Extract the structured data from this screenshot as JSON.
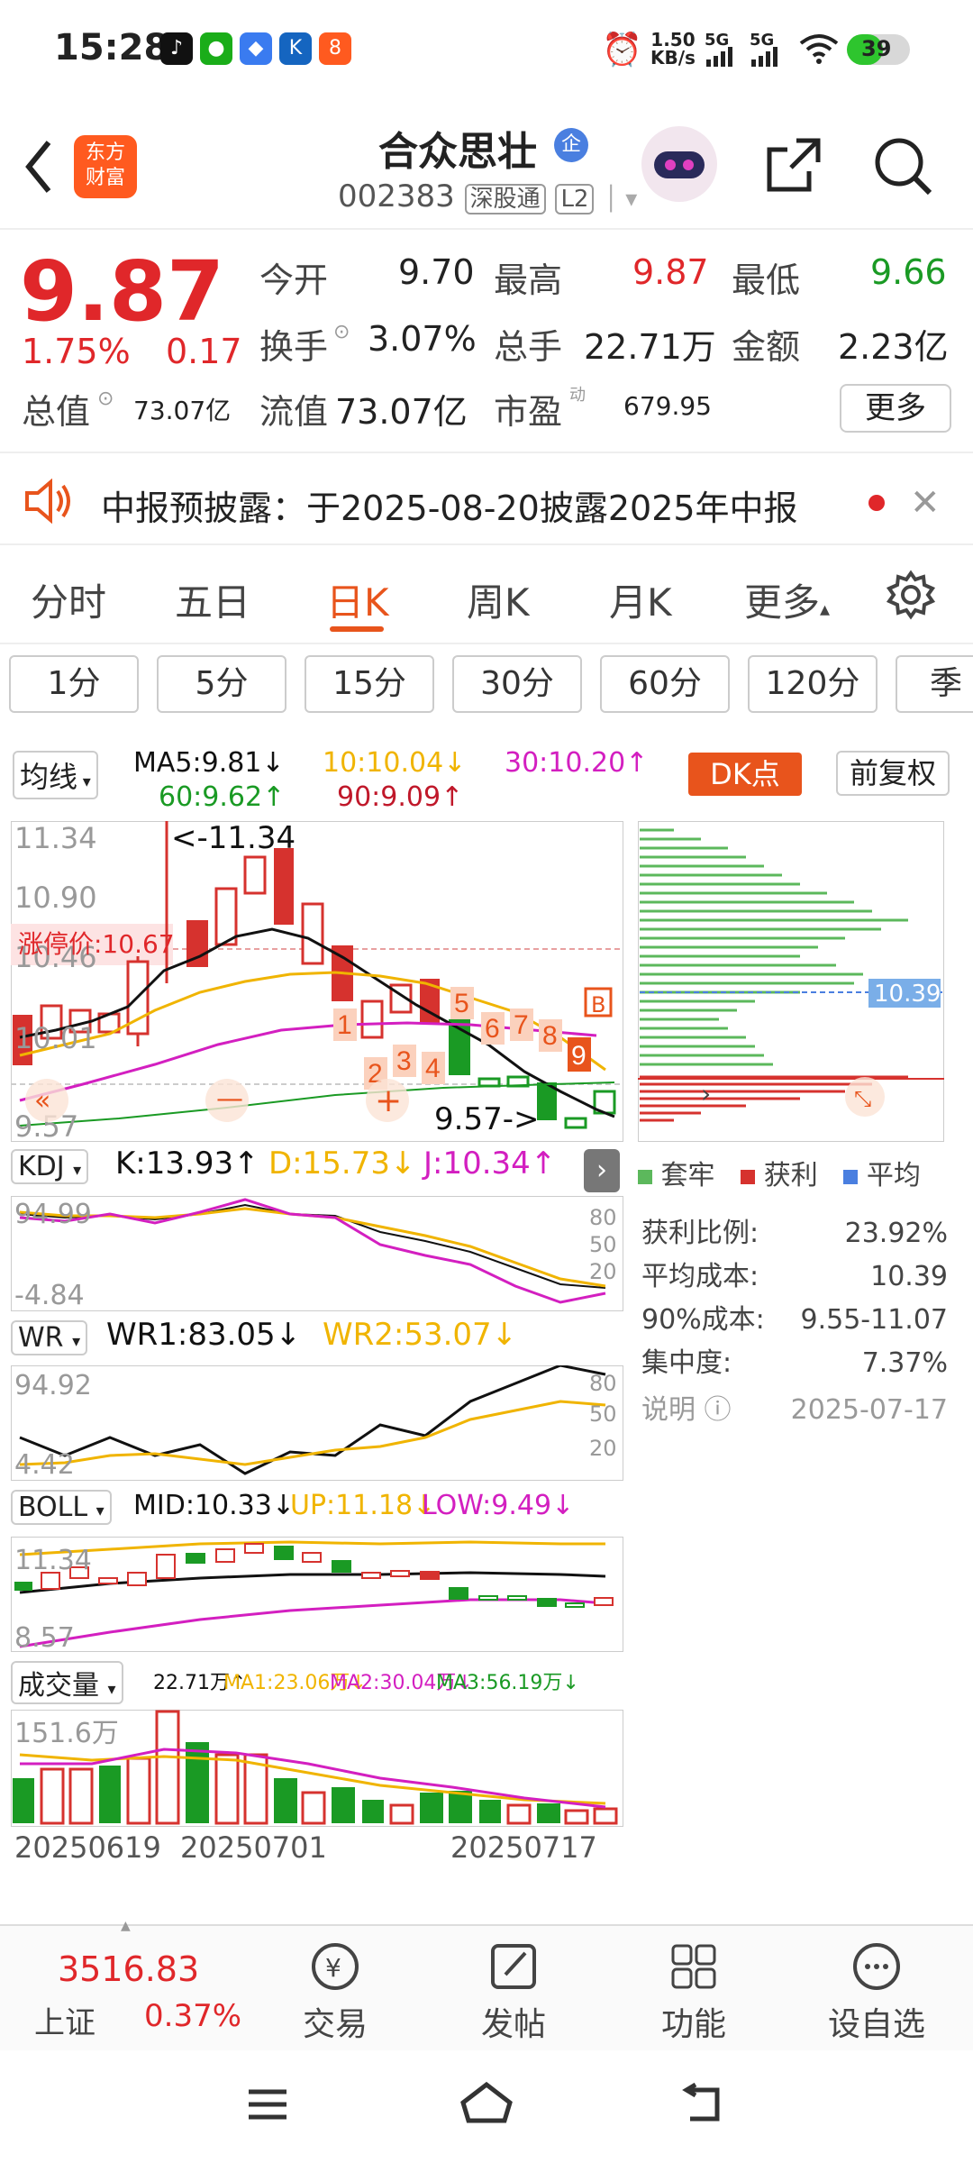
{
  "status": {
    "time": "15:28",
    "net_speed_value": "1.50",
    "net_speed_unit": "KB/s",
    "sig1": "5G",
    "sig2": "5G",
    "battery": "39"
  },
  "header": {
    "stock_name": "合众思壮",
    "company_badge": "企",
    "stock_code": "002383",
    "tag1": "深股通",
    "tag2": "L2",
    "logo_line1": "东方",
    "logo_line2": "财富"
  },
  "quote": {
    "price": "9.87",
    "change_pct": "1.75%",
    "change_amt": "0.17",
    "open_label": "今开",
    "open": "9.70",
    "high_label": "最高",
    "high": "9.87",
    "low_label": "最低",
    "low": "9.66",
    "turnover_label": "换手",
    "turnover": "3.07%",
    "volume_label": "总手",
    "volume": "22.71万",
    "amount_label": "金额",
    "amount": "2.23亿",
    "mktcap_label": "总值",
    "mktcap": "73.07亿",
    "float_label": "流值",
    "float_cap": "73.07亿",
    "pe_label": "市盈",
    "pe_sup": "动",
    "pe": "679.95",
    "more_button": "更多"
  },
  "notice": {
    "text": "中报预披露：于2025-08-20披露2025年中报"
  },
  "tabs": [
    "分时",
    "五日",
    "日K",
    "周K",
    "月K",
    "更多"
  ],
  "subtabs": [
    "1分",
    "5分",
    "15分",
    "30分",
    "60分",
    "120分",
    "季"
  ],
  "chart_top": {
    "ma_selector": "均线",
    "ma5": "MA5:9.81",
    "ma10": "10:10.04",
    "ma30": "30:10.20",
    "ma60": "60:9.62",
    "ma90": "90:9.09",
    "dk_button": "DK点",
    "adjust_button": "前复权"
  },
  "kline": {
    "y_ticks": [
      "11.34",
      "10.90",
      "10.46",
      "10.01",
      "9.57"
    ],
    "limit_label": "涨停价:10.67",
    "max_label": "<-11.34",
    "min_label": "9.57->",
    "b_marker": "B",
    "seq_numbers": [
      "1",
      "2",
      "3",
      "4",
      "5",
      "6",
      "7",
      "8",
      "9"
    ]
  },
  "chip": {
    "price_label": "10.39",
    "legend": [
      "套牢",
      "获利",
      "平均"
    ],
    "rows": [
      {
        "label": "获利比例:",
        "value": "23.92%"
      },
      {
        "label": "平均成本:",
        "value": "10.39"
      },
      {
        "label": "90%成本:",
        "value": "9.55-11.07"
      },
      {
        "label": "集中度:",
        "value": "7.37%"
      }
    ],
    "note_label": "说明",
    "date": "2025-07-17"
  },
  "kdj": {
    "selector": "KDJ",
    "k": "K:13.93",
    "d": "D:15.73",
    "j": "J:10.34",
    "top": "94.99",
    "bottom": "-4.84",
    "levels": [
      "80",
      "50",
      "20"
    ]
  },
  "wr": {
    "selector": "WR",
    "wr1": "WR1:83.05",
    "wr2": "WR2:53.07",
    "top": "94.92",
    "bottom": "4.42",
    "levels": [
      "80",
      "50",
      "20"
    ]
  },
  "boll": {
    "selector": "BOLL",
    "mid": "MID:10.33",
    "up": "UP:11.18",
    "low": "LOW:9.49",
    "top": "11.34",
    "bottom": "8.57"
  },
  "vol": {
    "selector": "成交量",
    "v": "22.71万",
    "ma1": "MA1:23.06万",
    "ma2": "MA2:30.04万",
    "ma3": "MA3:56.19万",
    "top": "151.6万"
  },
  "dates": [
    "20250619",
    "20250701",
    "20250717"
  ],
  "bottom_bar": {
    "index_value": "3516.83",
    "index_name": "上证",
    "index_change": "0.37%",
    "trade": "交易",
    "post": "发帖",
    "func": "功能",
    "watch": "设自选"
  },
  "colors": {
    "up": "#e0272a",
    "down": "#1a9a24",
    "accent": "#e8541c",
    "ma5": "#111111",
    "ma10": "#f0b400",
    "ma30": "#d31fc0"
  }
}
